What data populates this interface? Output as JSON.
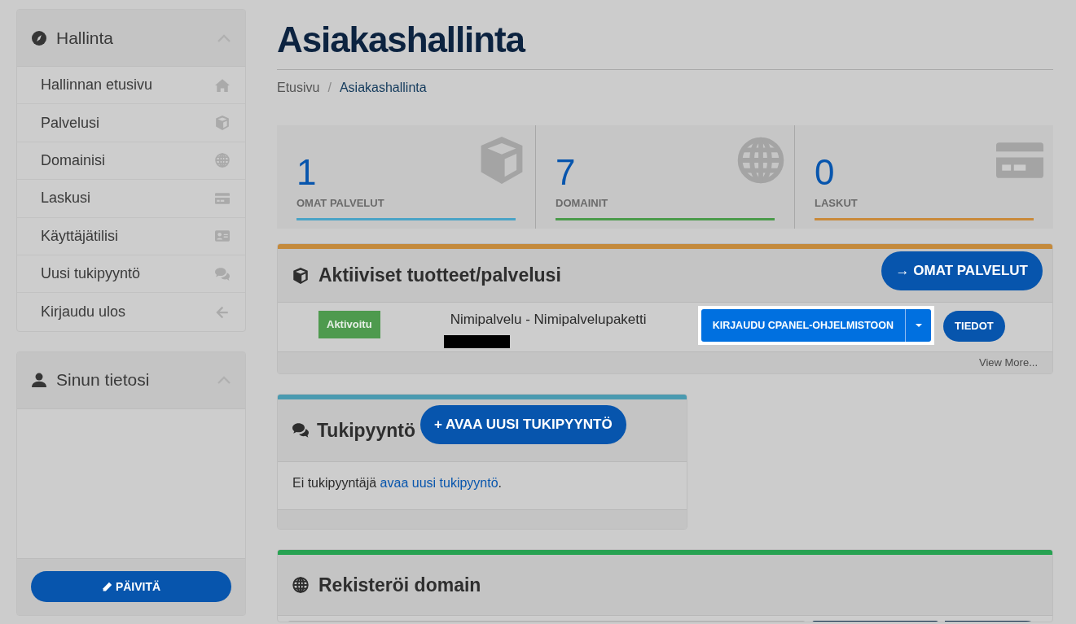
{
  "sidebar": [
    {
      "kind": "menu",
      "title": "Hallinta",
      "expanded": true,
      "items": [
        {
          "label": "Hallinnan etusivu",
          "kind": "home"
        },
        {
          "label": "Palvelusi",
          "kind": "services"
        },
        {
          "label": "Domainisi",
          "kind": "domains"
        },
        {
          "label": "Laskusi",
          "kind": "invoices"
        },
        {
          "label": "Käyttäjätilisi",
          "kind": "account"
        },
        {
          "label": "Uusi tukipyyntö",
          "kind": "ticket"
        },
        {
          "label": "Kirjaudu ulos",
          "kind": "logout"
        }
      ]
    },
    {
      "kind": "info",
      "title": "Sinun tietosi",
      "expanded": true,
      "button": "PÄIVITÄ"
    }
  ],
  "page": {
    "title": "Asiakashallinta",
    "breadcrumb_separator": "/",
    "breadcrumb": [
      {
        "label": "Etusivu",
        "selected": false
      },
      {
        "label": "Asiakashallinta",
        "selected": true
      }
    ]
  },
  "stats": [
    {
      "value": "1",
      "label": "OMAT PALVELUT",
      "kind": "services",
      "color": "#4aa3c6"
    },
    {
      "value": "7",
      "label": "DOMAINIT",
      "kind": "domains",
      "color": "#4a9a4a"
    },
    {
      "value": "0",
      "label": "LASKUT",
      "kind": "invoices",
      "color": "#c98a3a"
    }
  ],
  "services_panel": {
    "title": "Aktiiviset tuotteet/palvelusi",
    "color": "#c48a3c",
    "header_button": "→ OMAT PALVELUT",
    "rows": [
      {
        "status": "Aktivoitu",
        "product": "Nimipalvelu - Nimipalvelupaketti",
        "login_button": "KIRJAUDU CPANEL-OHJELMISTOON",
        "details_button": "TIEDOT"
      }
    ],
    "footer_link": "View More..."
  },
  "tickets_panel": {
    "title": "Tukipyyntö",
    "color": "#4a9ab0",
    "header_button": "+ AVAA UUSI TUKIPYYNTÖ",
    "message": "Ei tukipyyntäjä",
    "link": "avaa uusi tukipyyntö",
    "after": "."
  },
  "domain_panel": {
    "title": "Rekisteröi domain",
    "color": "#27a252"
  }
}
